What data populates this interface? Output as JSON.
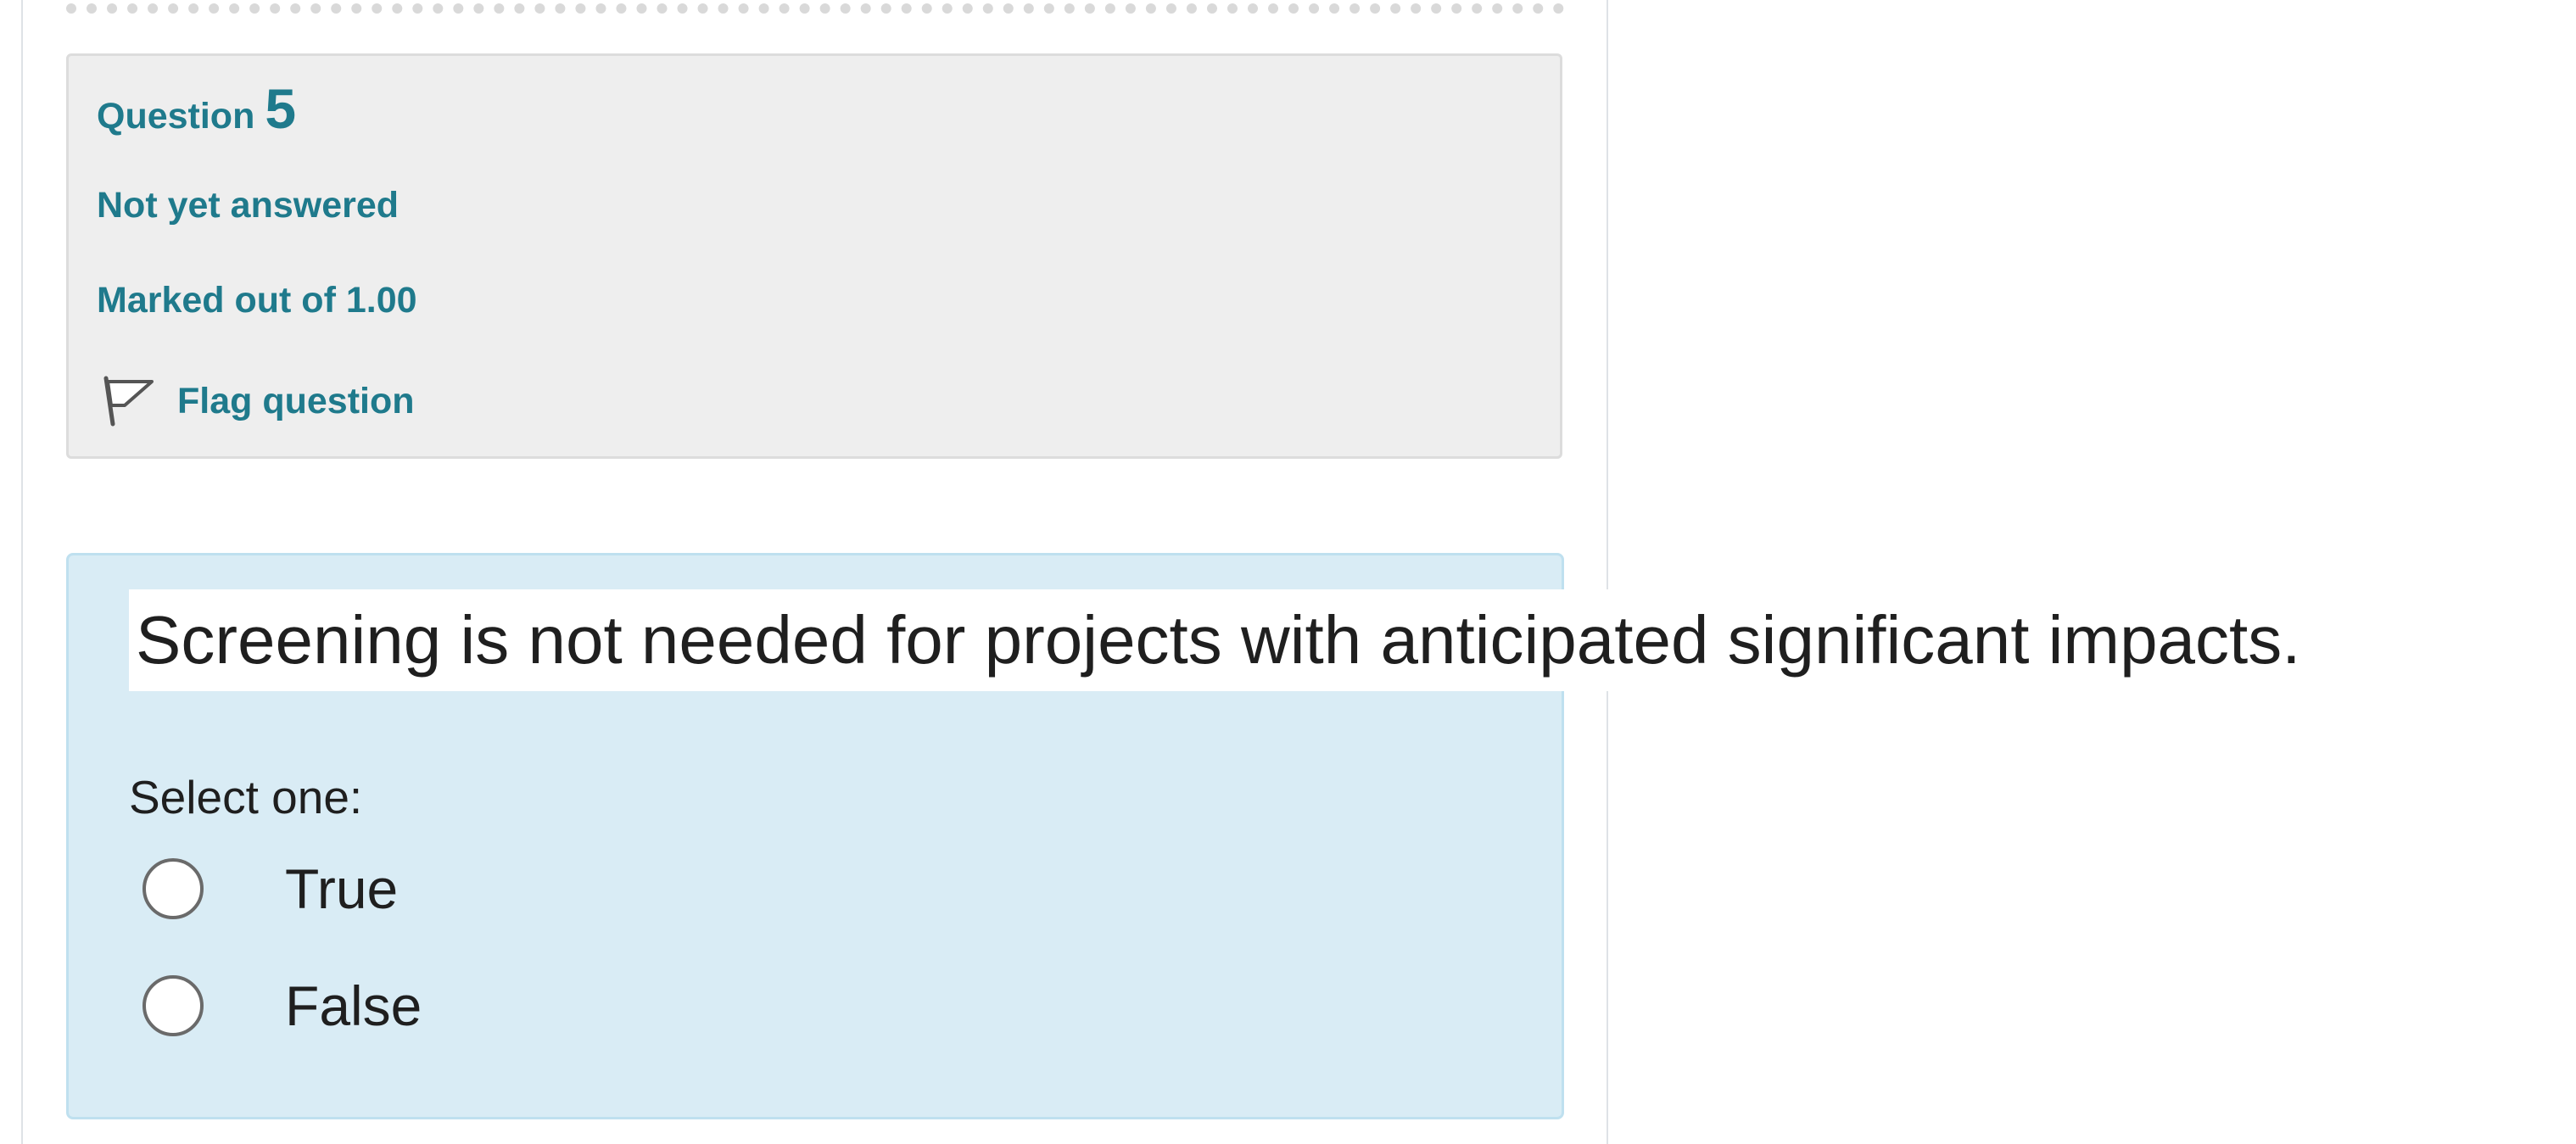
{
  "info": {
    "question_label": "Question",
    "question_number": "5",
    "state": "Not yet answered",
    "grade": "Marked out of 1.00",
    "flag_label": "Flag question",
    "flag_icon": "flag-icon"
  },
  "question": {
    "text": "Screening is not needed for projects with anticipated significant impacts.",
    "prompt": "Select one:",
    "options": [
      {
        "label": "True",
        "selected": false
      },
      {
        "label": "False",
        "selected": false
      }
    ]
  },
  "colors": {
    "accent": "#1f7a8c",
    "info_background": "#eeeeee",
    "content_background": "#d9ecf5"
  }
}
